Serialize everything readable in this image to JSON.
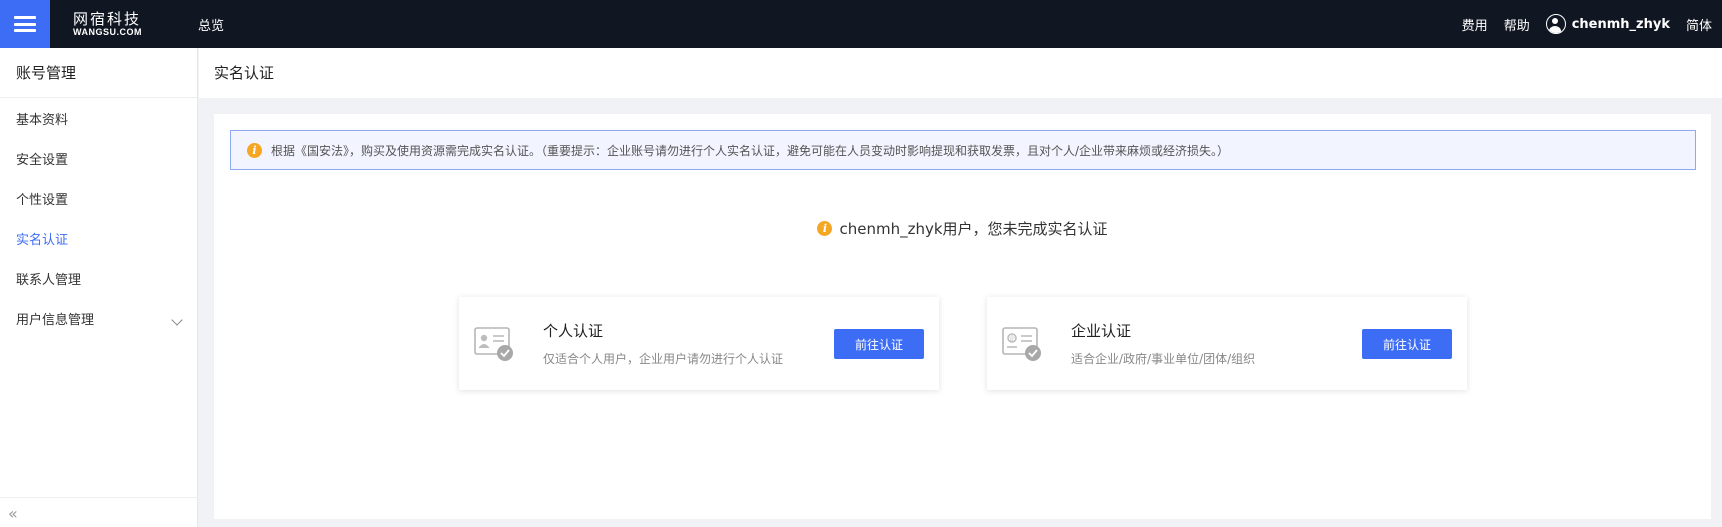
{
  "header": {
    "logo_cn": "网宿科技",
    "logo_en": "WANGSU.COM",
    "overview": "总览",
    "fees": "费用",
    "help": "帮助",
    "username": "chenmh_zhyk",
    "language": "简体"
  },
  "sidebar": {
    "title": "账号管理",
    "items": [
      {
        "label": "基本资料"
      },
      {
        "label": "安全设置"
      },
      {
        "label": "个性设置"
      },
      {
        "label": "实名认证"
      },
      {
        "label": "联系人管理"
      },
      {
        "label": "用户信息管理"
      }
    ],
    "collapse": "«"
  },
  "page": {
    "title": "实名认证",
    "notice": "根据《国安法》，购买及使用资源需完成实名认证。（重要提示：企业账号请勿进行个人实名认证，避免可能在人员变动时影响提现和获取发票，且对个人/企业带来麻烦或经济损失。）",
    "status": "chenmh_zhyk用户，您未完成实名认证",
    "cards": [
      {
        "title": "个人认证",
        "desc": "仅适合个人用户，企业用户请勿进行个人认证",
        "button": "前往认证",
        "icon": "id-card-check-icon"
      },
      {
        "title": "企业认证",
        "desc": "适合企业/政府/事业单位/团体/组织",
        "button": "前往认证",
        "icon": "id-card-check-icon"
      }
    ]
  },
  "colors": {
    "topbar_bg": "#101622",
    "accent": "#3d6df5",
    "warning": "#f5a623"
  }
}
